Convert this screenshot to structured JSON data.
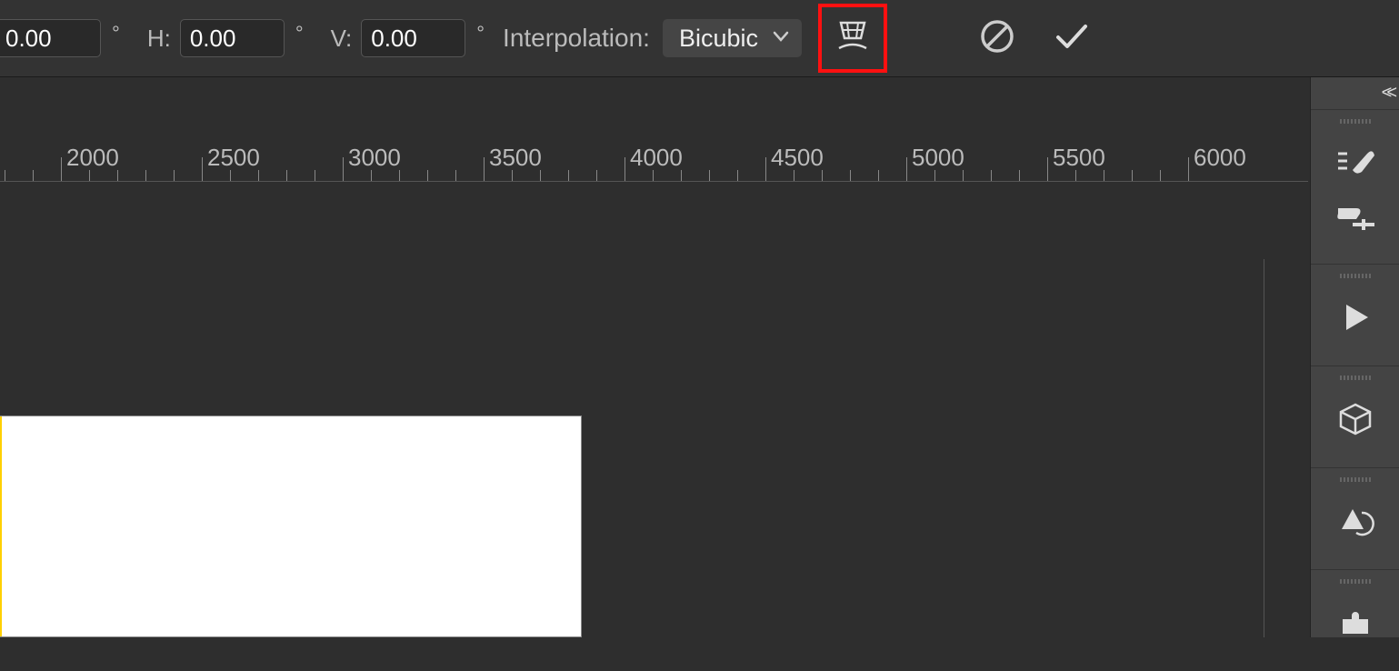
{
  "toolbar": {
    "angle_value_first": "0.00",
    "h_label": "H:",
    "h_value": "0.00",
    "v_label": "V:",
    "v_value": "0.00",
    "degree": "°",
    "interpolation_label": "Interpolation:",
    "interpolation_value": "Bicubic"
  },
  "ruler": {
    "start": 2000,
    "end": 6000,
    "step": 500,
    "minor_count": 5,
    "spacing_px": 155,
    "first_tick_left": 67
  },
  "panel": {
    "collapse": "<<"
  },
  "icons": {
    "warp": "warp-icon",
    "cancel": "cancel-icon",
    "commit": "check-icon",
    "brush_settings": "brush-settings-icon",
    "clone_source": "clone-source-icon",
    "play": "play-icon",
    "cube": "3d-cube-icon",
    "rotate": "rotate-shape-icon",
    "puzzle": "puzzle-icon"
  }
}
